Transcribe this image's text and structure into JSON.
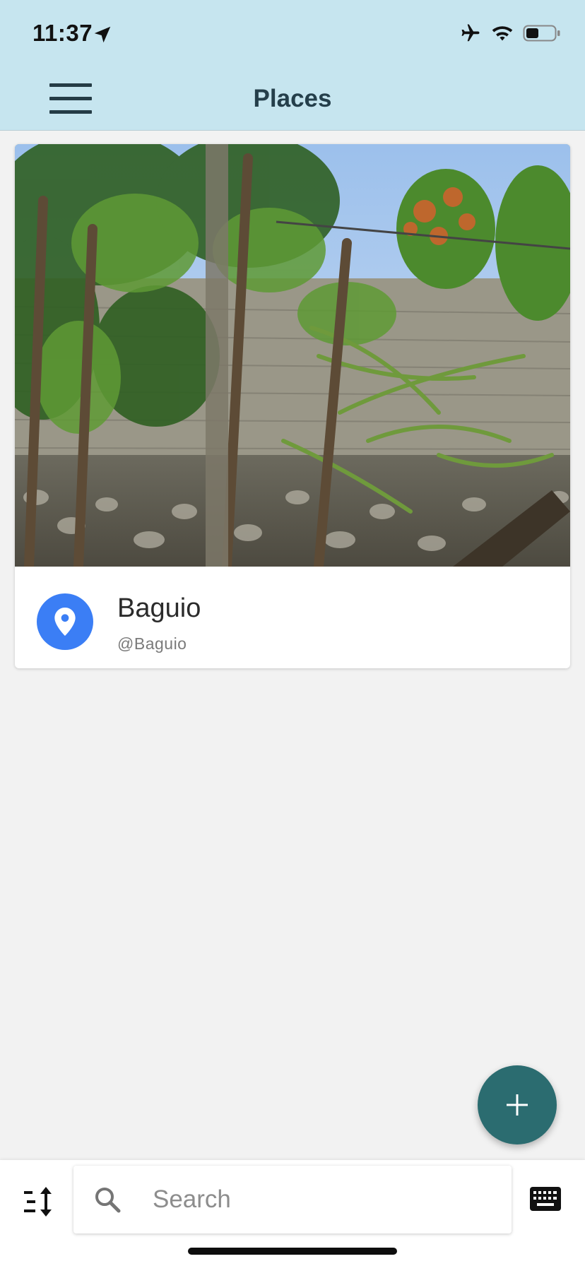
{
  "status_bar": {
    "time": "11:37",
    "icons": [
      "location-arrow-icon",
      "airplane-icon",
      "wifi-icon",
      "battery-icon"
    ]
  },
  "app_bar": {
    "title": "Places",
    "menu_icon": "hamburger-menu-icon"
  },
  "places": [
    {
      "name": "Baguio",
      "handle": "@Baguio",
      "icon": "map-pin-icon",
      "image": "photo of trees and dragon fruit cactus along a stone wall"
    }
  ],
  "fab": {
    "icon": "plus-icon"
  },
  "bottom_bar": {
    "sort_icon": "sort-icon",
    "search": {
      "placeholder": "Search",
      "value": "",
      "icon": "search-icon"
    },
    "keyboard_icon": "keyboard-icon"
  },
  "colors": {
    "app_bar_bg": "#c6e5ef",
    "title_text": "#253f4b",
    "page_bg": "#f2f2f2",
    "avatar_blue": "#3b7ef5",
    "fab_teal": "#2b6c70"
  }
}
